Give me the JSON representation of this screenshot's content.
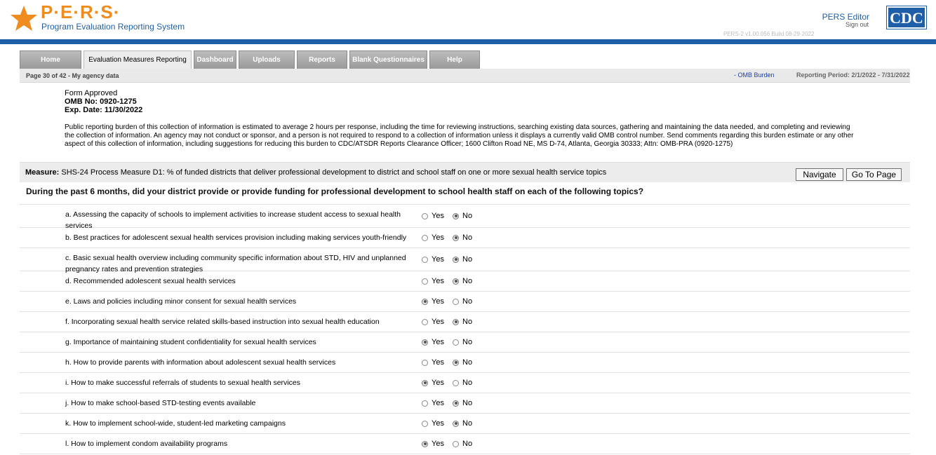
{
  "header": {
    "logo_text": "P·E·R·S·",
    "logo_subtitle": "Program Evaluation Reporting System",
    "user_name": "PERS Editor",
    "sign_out": "Sign out",
    "cdc_logo": "CDC",
    "build_info": "PERS-2 v1.00.056   Build 08-29-2022",
    "colors": {
      "brand_orange": "#f08c1e",
      "brand_blue": "#1f5fa8"
    }
  },
  "tabs": [
    {
      "label": "Home",
      "active": false
    },
    {
      "label": "Evaluation Measures Reporting",
      "active": true
    },
    {
      "label": "Dashboard",
      "active": false
    },
    {
      "label": "Uploads",
      "active": false
    },
    {
      "label": "Reports",
      "active": false
    },
    {
      "label": "Blank Questionnaires",
      "active": false
    },
    {
      "label": "Help",
      "active": false
    }
  ],
  "subbar": {
    "page_info": "Page 30 of 42 - My agency data",
    "omb_link": "- OMB Burden",
    "reporting_period": "Reporting Period: 2/1/2022 - 7/31/2022"
  },
  "approval": {
    "line1": "Form Approved",
    "line2": "OMB No: 0920-1275",
    "line3": "Exp. Date: 11/30/2022",
    "burden": "Public reporting burden of this collection of information is estimated to average 2 hours per response, including the time for reviewing instructions, searching existing data sources, gathering and maintaining the data needed, and completing and reviewing the collection of information. An agency may not conduct or sponsor, and a person is not required to respond to a collection of information unless it displays a currently valid OMB control number. Send comments regarding this burden estimate or any other aspect of this collection of information, including suggestions for reducing this burden to CDC/ATSDR Reports Clearance Officer; 1600 Clifton Road NE, MS D-74, Atlanta, Georgia 30333; Attn: OMB-PRA (0920-1275)"
  },
  "measure": {
    "label": "Measure:",
    "text": "SHS-24 Process Measure D1: % of funded districts that deliver professional development to district and school staff on one or more sexual health service topics",
    "navigate_button": "Navigate",
    "goto_button": "Go To Page"
  },
  "question": "During the past 6 months, did your district provide or provide funding for professional development to school health staff on each of the following topics?",
  "options": {
    "yes": "Yes",
    "no": "No"
  },
  "items": [
    {
      "label": "a. Assessing the capacity of schools to implement activities to increase student access to sexual health services",
      "answer": "No"
    },
    {
      "label": "b. Best practices for adolescent sexual health services provision including making services youth-friendly",
      "answer": "No"
    },
    {
      "label": "c. Basic sexual health overview including community specific information about STD, HIV and unplanned pregnancy rates and prevention strategies",
      "answer": "No"
    },
    {
      "label": "d. Recommended adolescent sexual health services",
      "answer": "No"
    },
    {
      "label": "e. Laws and policies including minor consent for sexual health services",
      "answer": "Yes"
    },
    {
      "label": "f. Incorporating sexual health service related skills-based instruction into sexual health education",
      "answer": "No"
    },
    {
      "label": "g. Importance of maintaining student confidentiality for sexual health services",
      "answer": "Yes"
    },
    {
      "label": "h. How to provide parents with information about adolescent sexual health services",
      "answer": "No"
    },
    {
      "label": "i. How to make successful referrals of students to sexual health services",
      "answer": "Yes"
    },
    {
      "label": "j. How to make school-based STD-testing events available",
      "answer": "No"
    },
    {
      "label": "k. How to implement school-wide, student-led marketing campaigns",
      "answer": "No"
    },
    {
      "label": "l. How to implement condom availability programs",
      "answer": "Yes"
    }
  ]
}
